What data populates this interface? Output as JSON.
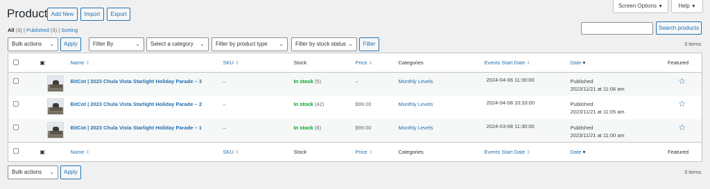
{
  "page": {
    "title": "Products"
  },
  "header_buttons": {
    "add_new": "Add New",
    "import": "Import",
    "export": "Export"
  },
  "top_right": {
    "screen_options": "Screen Options",
    "help": "Help"
  },
  "views": {
    "all": "All",
    "all_count": "(3)",
    "published": "Published",
    "published_count": "(3)",
    "sorting": "Sorting",
    "sep": "|"
  },
  "search": {
    "value": "",
    "button": "Search products"
  },
  "filters": {
    "bulk_actions": "Bulk actions",
    "apply": "Apply",
    "filter_by": "Filter By",
    "category": "Select a category",
    "product_type": "Filter by product type",
    "stock_status": "Filter by stock status",
    "filter_button": "Filter"
  },
  "items_count": "3 items",
  "columns": {
    "name": "Name",
    "sku": "SKU",
    "stock": "Stock",
    "price": "Price",
    "categories": "Categories",
    "events_start_date": "Events Start Date",
    "date": "Date",
    "featured": "Featured"
  },
  "sort_icon": "⇕",
  "sort_desc_icon": "▾",
  "rows": [
    {
      "name": "BitCot | 2023 Chula Vista Starlight Holiday Parade – 3",
      "sku": "–",
      "stock_label": "In stock",
      "stock_qty": "(5)",
      "price": "–",
      "category": "Monthly Levels",
      "event_start": "2024-04-06 11:30:00",
      "status": "Published",
      "date": "2023/11/21 at 11:06 am"
    },
    {
      "name": "BitCot | 2023 Chula Vista Starlight Holiday Parade – 2",
      "sku": "–",
      "stock_label": "In stock",
      "stock_qty": "(42)",
      "price": "$99.00",
      "category": "Monthly Levels",
      "event_start": "2024-04-08 10:33:00",
      "status": "Published",
      "date": "2023/11/21 at 11:05 am"
    },
    {
      "name": "BitCot | 2023 Chula Vista Starlight Holiday Parade – 1",
      "sku": "–",
      "stock_label": "In stock",
      "stock_qty": "(6)",
      "price": "$99.00",
      "category": "Monthly Levels",
      "event_start": "2024-03-08 11:30:00",
      "status": "Published",
      "date": "2023/11/21 at 11:00 am"
    }
  ],
  "icons": {
    "image_column": "image-icon",
    "star": "star-icon",
    "chevron": "chevron-down-icon"
  },
  "colors": {
    "accent": "#2271b1",
    "in_stock": "#00a32a",
    "background": "#f0f0f1"
  }
}
